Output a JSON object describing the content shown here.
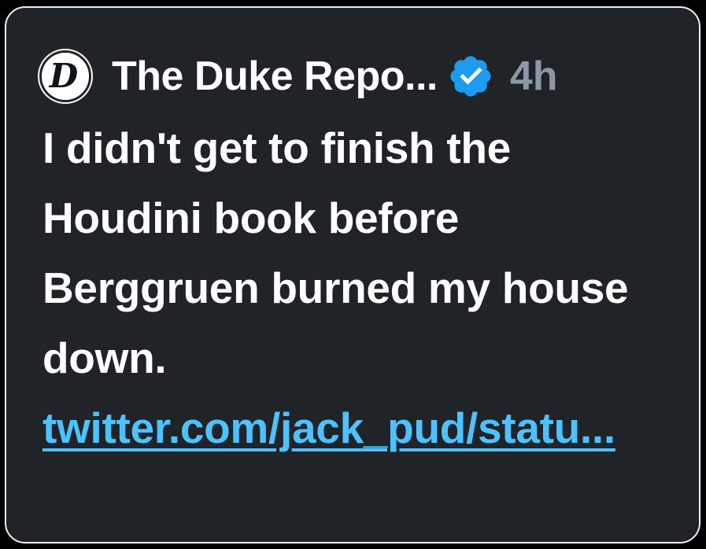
{
  "tweet": {
    "avatar_letter": "D",
    "author_name": "The Duke Repo...",
    "verified_icon": "verified-badge-icon",
    "timestamp": "4h",
    "text": "I didn't get to finish the Houdini book before Berggruen burned my house down.",
    "link_text": "twitter.com/jack_pud/statu..."
  },
  "colors": {
    "background": "#202327",
    "border": "#eceef0",
    "text": "#ffffff",
    "muted": "#8b98a5",
    "link": "#4cc2ff",
    "verified": "#1d9bf0"
  }
}
